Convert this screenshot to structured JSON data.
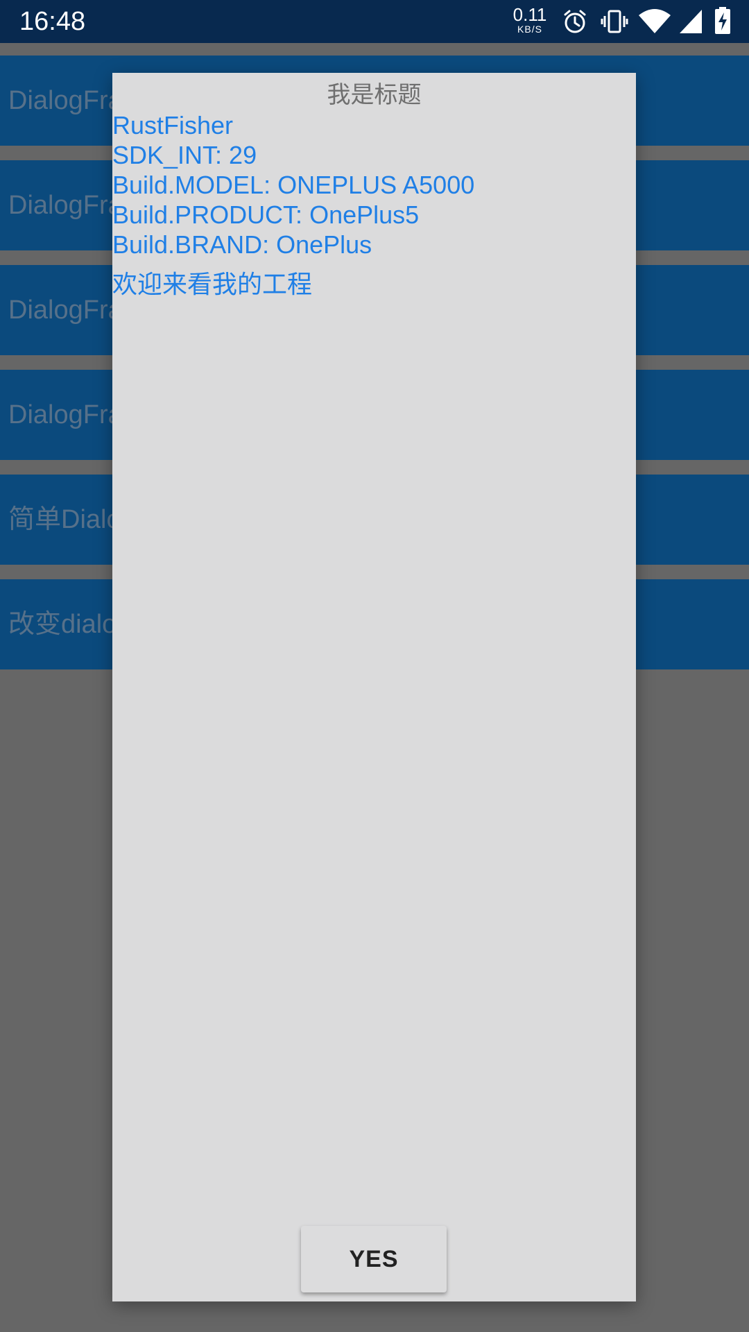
{
  "status_bar": {
    "time": "16:48",
    "net_speed": "0.11",
    "net_unit": "KB/S",
    "icons": [
      "alarm-icon",
      "vibrate-icon",
      "wifi-icon",
      "signal-icon",
      "battery-charging-icon"
    ]
  },
  "background_list": {
    "items": [
      {
        "label": "DialogFra"
      },
      {
        "label": "DialogFra"
      },
      {
        "label": "DialogFra"
      },
      {
        "label": "DialogFra"
      },
      {
        "label": "简单Dialo"
      },
      {
        "label": "改变dialo"
      }
    ]
  },
  "dialog": {
    "title": "我是标题",
    "info_lines": [
      "RustFisher",
      "SDK_INT: 29",
      "Build.MODEL: ONEPLUS A5000",
      "Build.PRODUCT: OnePlus5",
      "Build.BRAND: OnePlus"
    ],
    "welcome": "欢迎来看我的工程",
    "yes_label": "YES"
  },
  "colors": {
    "status_bar": "#08294f",
    "list_item": "#0b4a7d",
    "dim_background": "#666666",
    "dialog_background": "#dbdbdc",
    "info_text": "#1f7fe6",
    "title_text": "#6f6f6f"
  }
}
